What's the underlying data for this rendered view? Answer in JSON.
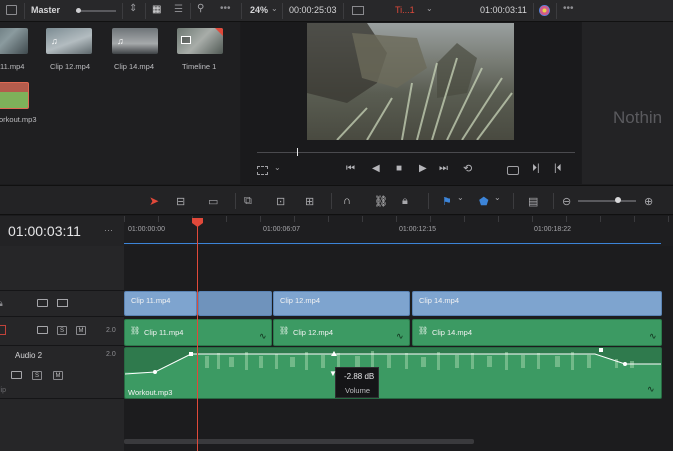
{
  "topbar": {
    "bin_name": "Master",
    "zoom": "24%",
    "source_timecode": "00:00:25:03",
    "timeline_name": "Ti...1",
    "record_timecode": "01:00:03:11"
  },
  "media_pool": {
    "items": [
      {
        "label": "11.mp4"
      },
      {
        "label": "Clip 12.mp4"
      },
      {
        "label": "Clip 14.mp4"
      },
      {
        "label": "Timeline 1"
      },
      {
        "label": "orkout.mp3"
      }
    ]
  },
  "inspector": {
    "placeholder": "Nothin"
  },
  "timeline": {
    "current_timecode": "01:00:03:11",
    "ruler_ticks": [
      "01:00:00:00",
      "01:00:06:07",
      "01:00:12:15",
      "01:00:18:22"
    ],
    "tracks": {
      "video_clips": [
        "Clip 11.mp4",
        "Clip 12.mp4",
        "Clip 14.mp4"
      ],
      "audio1_clips": [
        "Clip 11.mp4",
        "Clip 12.mp4",
        "Clip 14.mp4"
      ],
      "audio1_level": "2.0",
      "audio2_name": "Audio 2",
      "audio2_level": "2.0",
      "audio2_clip": "Workout.mp3",
      "audio2_type": "Clip"
    },
    "solo_label": "S",
    "mute_label": "M",
    "tooltip": {
      "value": "-2.88 dB",
      "caption": "Volume"
    }
  },
  "colors": {
    "video_clip": "#7ea4cf",
    "audio_clip": "#3c9a63",
    "playhead": "#e0493a",
    "accent_blue": "#3c84d8"
  }
}
